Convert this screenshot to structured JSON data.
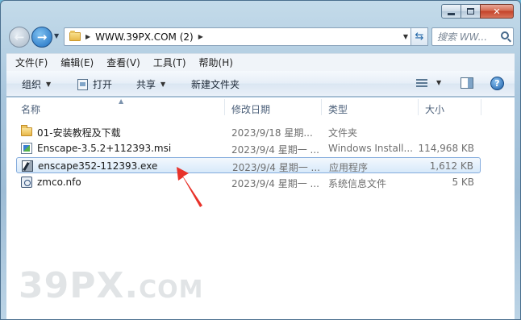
{
  "address": {
    "path": "WWW.39PX.COM (2)"
  },
  "search": {
    "placeholder": "搜索 WW..."
  },
  "menu": [
    "文件(F)",
    "编辑(E)",
    "查看(V)",
    "工具(T)",
    "帮助(H)"
  ],
  "toolbar": {
    "organize": "组织",
    "open": "打开",
    "share": "共享",
    "new_folder": "新建文件夹"
  },
  "columns": {
    "name": "名称",
    "date": "修改日期",
    "type": "类型",
    "size": "大小"
  },
  "files": [
    {
      "name": "01-安装教程及下载",
      "date": "2023/9/18 星期...",
      "type": "文件夹",
      "size": "",
      "icon": "folder-icon",
      "selected": false
    },
    {
      "name": "Enscape-3.5.2+112393.msi",
      "date": "2023/9/4 星期一 ...",
      "type": "Windows Install...",
      "size": "114,968 KB",
      "icon": "msi-icon",
      "selected": false
    },
    {
      "name": "enscape352-112393.exe",
      "date": "2023/9/4 星期一 ...",
      "type": "应用程序",
      "size": "1,612 KB",
      "icon": "exe-icon",
      "selected": true
    },
    {
      "name": "zmco.nfo",
      "date": "2023/9/4 星期一 ...",
      "type": "系统信息文件",
      "size": "5 KB",
      "icon": "nfo-icon",
      "selected": false
    }
  ],
  "watermark": {
    "main": "39PX.",
    "suffix": "COM"
  },
  "colors": {
    "annotation_arrow": "#e8322a",
    "selection_border": "#84acdd"
  }
}
